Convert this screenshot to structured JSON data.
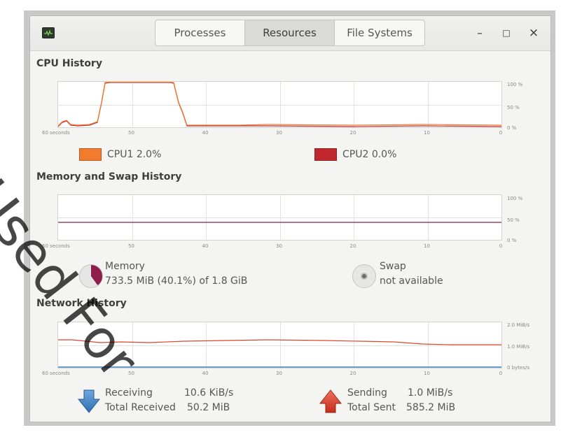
{
  "tabs": [
    {
      "label": "Processes",
      "active": false
    },
    {
      "label": "Resources",
      "active": true
    },
    {
      "label": "File Systems",
      "active": false
    }
  ],
  "window_controls": {
    "minimize": "–",
    "maximize": "□",
    "close": "×"
  },
  "cpu": {
    "title": "CPU History",
    "x_ticks": [
      "60 seconds",
      "50",
      "40",
      "30",
      "20",
      "10",
      "0"
    ],
    "y_ticks": [
      "100 %",
      "50 %",
      "0 %"
    ],
    "legend": [
      {
        "label": "CPU1  2.0%",
        "color": "#f37b2d"
      },
      {
        "label": "CPU2  0.0%",
        "color": "#c0282e"
      }
    ]
  },
  "memory": {
    "title": "Memory and Swap History",
    "x_ticks": [
      "60 seconds",
      "50",
      "40",
      "30",
      "20",
      "10",
      "0"
    ],
    "y_ticks": [
      "100 %",
      "50 %",
      "0 %"
    ],
    "memory_label": "Memory",
    "memory_value": "733.5 MiB (40.1%) of 1.8 GiB",
    "memory_fraction": 0.401,
    "memory_color": "#8f1d4e",
    "swap_label": "Swap",
    "swap_value": "not available"
  },
  "network": {
    "title": "Network History",
    "x_ticks": [
      "60 seconds",
      "50",
      "40",
      "30",
      "20",
      "10",
      "0"
    ],
    "y_ticks": [
      "2.0 MiB/s",
      "1.0 MiB/s",
      "0 bytes/s"
    ],
    "receiving_label": "Receiving",
    "receiving_value": "10.6 KiB/s",
    "total_received_label": "Total Received",
    "total_received_value": "50.2 MiB",
    "sending_label": "Sending",
    "sending_value": "1.0 MiB/s",
    "total_sent_label": "Total Sent",
    "total_sent_value": "585.2 MiB",
    "receive_color": "#3a7fc4",
    "send_color": "#e0452b"
  },
  "watermark": "Used For"
}
